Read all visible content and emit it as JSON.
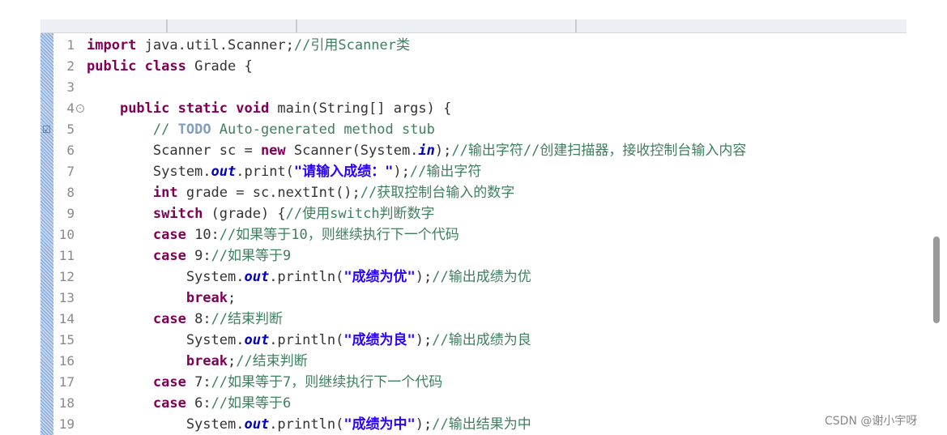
{
  "editor": {
    "lines": [
      {
        "num": "1",
        "tokens": [
          {
            "t": "kw",
            "v": "import"
          },
          {
            "t": "p",
            "v": " java.util.Scanner;"
          },
          {
            "t": "cm",
            "v": "//引用Scanner类"
          }
        ]
      },
      {
        "num": "2",
        "tokens": [
          {
            "t": "kw",
            "v": "public class"
          },
          {
            "t": "p",
            "v": " Grade {"
          }
        ]
      },
      {
        "num": "3",
        "tokens": []
      },
      {
        "num": "4",
        "fold": true,
        "tokens": [
          {
            "t": "p",
            "v": "    "
          },
          {
            "t": "kw",
            "v": "public static void"
          },
          {
            "t": "p",
            "v": " main(String[] args) {"
          }
        ]
      },
      {
        "num": "5",
        "task": true,
        "tokens": [
          {
            "t": "p",
            "v": "        "
          },
          {
            "t": "cm",
            "v": "// "
          },
          {
            "t": "todo",
            "v": "TODO"
          },
          {
            "t": "cm",
            "v": " Auto-generated method stub"
          }
        ]
      },
      {
        "num": "6",
        "tokens": [
          {
            "t": "p",
            "v": "        Scanner sc = "
          },
          {
            "t": "kw",
            "v": "new"
          },
          {
            "t": "p",
            "v": " Scanner(System."
          },
          {
            "t": "fld",
            "v": "in"
          },
          {
            "t": "p",
            "v": ");"
          },
          {
            "t": "cm",
            "v": "//输出字符//创建扫描器，接收控制台输入内容"
          }
        ]
      },
      {
        "num": "7",
        "tokens": [
          {
            "t": "p",
            "v": "        System."
          },
          {
            "t": "fld",
            "v": "out"
          },
          {
            "t": "p",
            "v": ".print("
          },
          {
            "t": "str",
            "v": "\"请输入成绩：\""
          },
          {
            "t": "p",
            "v": ");"
          },
          {
            "t": "cm",
            "v": "//输出字符"
          }
        ]
      },
      {
        "num": "8",
        "tokens": [
          {
            "t": "p",
            "v": "        "
          },
          {
            "t": "kw",
            "v": "int"
          },
          {
            "t": "p",
            "v": " grade = sc.nextInt();"
          },
          {
            "t": "cm",
            "v": "//获取控制台输入的数字"
          }
        ]
      },
      {
        "num": "9",
        "tokens": [
          {
            "t": "p",
            "v": "        "
          },
          {
            "t": "kw",
            "v": "switch"
          },
          {
            "t": "p",
            "v": " (grade) {"
          },
          {
            "t": "cm",
            "v": "//使用switch判断数字"
          }
        ]
      },
      {
        "num": "10",
        "tokens": [
          {
            "t": "p",
            "v": "        "
          },
          {
            "t": "kw",
            "v": "case"
          },
          {
            "t": "p",
            "v": " 10:"
          },
          {
            "t": "cm",
            "v": "//如果等于10，则继续执行下一个代码"
          }
        ]
      },
      {
        "num": "11",
        "tokens": [
          {
            "t": "p",
            "v": "        "
          },
          {
            "t": "kw",
            "v": "case"
          },
          {
            "t": "p",
            "v": " 9:"
          },
          {
            "t": "cm",
            "v": "//如果等于9"
          }
        ]
      },
      {
        "num": "12",
        "tokens": [
          {
            "t": "p",
            "v": "            System."
          },
          {
            "t": "fld",
            "v": "out"
          },
          {
            "t": "p",
            "v": ".println("
          },
          {
            "t": "str",
            "v": "\"成绩为优\""
          },
          {
            "t": "p",
            "v": ");"
          },
          {
            "t": "cm",
            "v": "//输出成绩为优"
          }
        ]
      },
      {
        "num": "13",
        "tokens": [
          {
            "t": "p",
            "v": "            "
          },
          {
            "t": "kw",
            "v": "break"
          },
          {
            "t": "p",
            "v": ";"
          }
        ]
      },
      {
        "num": "14",
        "tokens": [
          {
            "t": "p",
            "v": "        "
          },
          {
            "t": "kw",
            "v": "case"
          },
          {
            "t": "p",
            "v": " 8:"
          },
          {
            "t": "cm",
            "v": "//结束判断"
          }
        ]
      },
      {
        "num": "15",
        "tokens": [
          {
            "t": "p",
            "v": "            System."
          },
          {
            "t": "fld",
            "v": "out"
          },
          {
            "t": "p",
            "v": ".println("
          },
          {
            "t": "str",
            "v": "\"成绩为良\""
          },
          {
            "t": "p",
            "v": ");"
          },
          {
            "t": "cm",
            "v": "//输出成绩为良"
          }
        ]
      },
      {
        "num": "16",
        "tokens": [
          {
            "t": "p",
            "v": "            "
          },
          {
            "t": "kw",
            "v": "break"
          },
          {
            "t": "p",
            "v": ";"
          },
          {
            "t": "cm",
            "v": "//结束判断"
          }
        ]
      },
      {
        "num": "17",
        "tokens": [
          {
            "t": "p",
            "v": "        "
          },
          {
            "t": "kw",
            "v": "case"
          },
          {
            "t": "p",
            "v": " 7:"
          },
          {
            "t": "cm",
            "v": "//如果等于7，则继续执行下一个代码"
          }
        ]
      },
      {
        "num": "18",
        "tokens": [
          {
            "t": "p",
            "v": "        "
          },
          {
            "t": "kw",
            "v": "case"
          },
          {
            "t": "p",
            "v": " 6:"
          },
          {
            "t": "cm",
            "v": "//如果等于6"
          }
        ]
      },
      {
        "num": "19",
        "tokens": [
          {
            "t": "p",
            "v": "            System."
          },
          {
            "t": "fld",
            "v": "out"
          },
          {
            "t": "p",
            "v": ".println("
          },
          {
            "t": "str",
            "v": "\"成绩为中\""
          },
          {
            "t": "p",
            "v": ");"
          },
          {
            "t": "cm",
            "v": "//输出结果为中"
          }
        ]
      }
    ]
  },
  "watermark": "CSDN @谢小宇呀",
  "icons": {
    "fold": "fold-collapse-icon",
    "task": "task-marker-icon"
  },
  "colors": {
    "keyword": "#7f0055",
    "field": "#0000c0",
    "string": "#2a00ff",
    "comment": "#3f7f5f",
    "todo": "#7f9fbf"
  }
}
